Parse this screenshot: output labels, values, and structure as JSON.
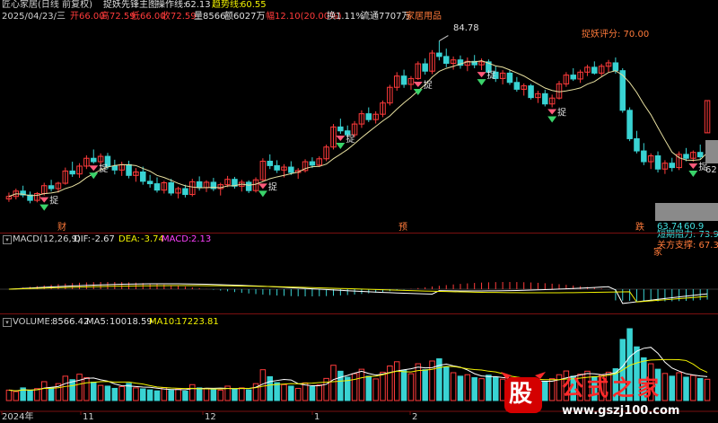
{
  "window": {
    "title": "匠心家居(日线 前复权)"
  },
  "header": {
    "date": "2025/04/23/三",
    "open_label": "开",
    "open": "66.00",
    "high_label": "高",
    "high": "72.59",
    "low_label": "低",
    "low": "66.00",
    "close_label": "收",
    "close": "72.59",
    "vol_label": "量",
    "vol": "8566",
    "amount_label": "额",
    "amount": "6027万",
    "chg_label": "幅",
    "chg": "12.10(20.00%)",
    "turnover": "换1.11%",
    "float": "流通7707万",
    "industry": "家居用品"
  },
  "indicator": {
    "name": "捉妖先锋主图",
    "op_label": "操作线:",
    "op_value": "62.13",
    "trend_label": "趋势线:",
    "trend_value": "60.55"
  },
  "annotations": {
    "peak": "84.78",
    "score": "捉妖评分: 70.00",
    "catch": "捉",
    "price_mark": "62",
    "low_mark": "63.74",
    "low_value": "60.9",
    "resistance": "短期阻力: 73.91",
    "support": "关方支撑: 67.32",
    "event_cai": "财",
    "event_yu": "预",
    "event_die": "跌",
    "event_jia": "家"
  },
  "macd": {
    "title": "MACD(12,26,9)",
    "dif_label": "DIF:",
    "dif": "-2.67",
    "dea_label": "DEA:",
    "dea": "-3.74",
    "macd_label": "MACD:",
    "macd": "2.13"
  },
  "volume": {
    "title": "VOLUME:",
    "value": "8566.42",
    "ma5_label": "MA5:",
    "ma5": "10018.59",
    "ma10_label": "MA10:",
    "ma10": "17223.81"
  },
  "xaxis": {
    "year": "2024年",
    "m11": "11",
    "m12": "12",
    "m1": "1",
    "m2": "2"
  },
  "watermark": {
    "logo": "股",
    "name": "公式之家",
    "url": "www.gszj100.com"
  },
  "colors": {
    "up": "#ff3b3b",
    "down": "#39d3d3",
    "bg": "#000000",
    "ma": "#e8e0a0"
  },
  "chart_data": {
    "type": "candlestick",
    "ylim": [
      48,
      88
    ],
    "candles": [
      [
        52.5,
        53.8,
        51.9,
        53.0
      ],
      [
        53.0,
        54.6,
        52.4,
        54.1
      ],
      [
        54.1,
        55.2,
        52.8,
        53.3
      ],
      [
        53.3,
        54.0,
        51.6,
        52.2
      ],
      [
        52.2,
        53.9,
        51.8,
        53.6
      ],
      [
        53.6,
        55.8,
        53.2,
        55.2
      ],
      [
        55.2,
        56.4,
        54.0,
        54.6
      ],
      [
        54.6,
        56.0,
        53.8,
        55.7
      ],
      [
        55.7,
        58.9,
        55.4,
        58.2
      ],
      [
        58.2,
        60.1,
        57.0,
        57.6
      ],
      [
        57.6,
        59.8,
        56.8,
        59.2
      ],
      [
        59.2,
        61.4,
        58.6,
        60.8
      ],
      [
        60.8,
        62.6,
        59.7,
        60.1
      ],
      [
        60.1,
        61.8,
        58.9,
        61.2
      ],
      [
        61.2,
        61.9,
        58.6,
        59.2
      ],
      [
        59.2,
        60.5,
        57.5,
        58.4
      ],
      [
        58.4,
        60.1,
        57.2,
        59.5
      ],
      [
        59.5,
        60.3,
        56.7,
        57.3
      ],
      [
        57.3,
        58.8,
        56.0,
        58.0
      ],
      [
        58.0,
        59.1,
        55.4,
        56.1
      ],
      [
        56.1,
        57.4,
        54.8,
        55.6
      ],
      [
        55.6,
        56.9,
        53.8,
        54.3
      ],
      [
        54.3,
        56.2,
        53.6,
        55.8
      ],
      [
        55.8,
        56.6,
        53.2,
        53.7
      ],
      [
        53.7,
        55.0,
        52.6,
        54.6
      ],
      [
        54.6,
        55.4,
        52.8,
        53.4
      ],
      [
        53.4,
        56.6,
        53.0,
        56.0
      ],
      [
        56.0,
        57.1,
        54.2,
        54.8
      ],
      [
        54.8,
        56.3,
        53.9,
        55.9
      ],
      [
        55.9,
        56.8,
        54.1,
        54.6
      ],
      [
        54.6,
        55.8,
        53.2,
        55.4
      ],
      [
        55.4,
        57.2,
        54.9,
        56.5
      ],
      [
        56.5,
        57.0,
        54.6,
        55.1
      ],
      [
        55.1,
        56.4,
        54.0,
        55.9
      ],
      [
        55.9,
        56.3,
        53.7,
        54.2
      ],
      [
        54.2,
        56.9,
        53.8,
        56.4
      ],
      [
        56.4,
        60.8,
        56.0,
        60.2
      ],
      [
        60.2,
        61.6,
        58.6,
        59.3
      ],
      [
        59.3,
        60.4,
        57.8,
        58.4
      ],
      [
        58.4,
        59.6,
        56.9,
        59.0
      ],
      [
        59.0,
        60.2,
        57.4,
        57.9
      ],
      [
        57.9,
        58.8,
        56.6,
        58.3
      ],
      [
        58.3,
        60.6,
        57.9,
        60.1
      ],
      [
        60.1,
        61.0,
        58.8,
        59.4
      ],
      [
        59.4,
        61.2,
        59.0,
        60.7
      ],
      [
        60.7,
        63.6,
        60.2,
        63.1
      ],
      [
        63.1,
        67.8,
        62.6,
        67.2
      ],
      [
        67.2,
        68.9,
        65.8,
        66.4
      ],
      [
        66.4,
        67.5,
        64.9,
        65.6
      ],
      [
        65.6,
        68.4,
        65.1,
        67.8
      ],
      [
        67.8,
        70.6,
        67.0,
        69.9
      ],
      [
        69.9,
        71.2,
        68.2,
        68.7
      ],
      [
        68.7,
        70.4,
        67.9,
        69.8
      ],
      [
        69.8,
        72.6,
        69.2,
        72.1
      ],
      [
        72.1,
        75.8,
        71.6,
        75.3
      ],
      [
        75.3,
        78.4,
        74.6,
        77.6
      ],
      [
        77.6,
        78.9,
        75.2,
        75.9
      ],
      [
        75.9,
        77.6,
        74.8,
        77.1
      ],
      [
        77.1,
        80.6,
        76.8,
        80.1
      ],
      [
        80.1,
        81.2,
        77.9,
        78.6
      ],
      [
        78.6,
        82.9,
        78.0,
        82.3
      ],
      [
        82.3,
        84.78,
        80.8,
        81.6
      ],
      [
        81.6,
        83.2,
        79.4,
        80.2
      ],
      [
        80.2,
        81.6,
        78.9,
        80.9
      ],
      [
        80.9,
        81.8,
        79.1,
        79.8
      ],
      [
        79.8,
        81.4,
        78.6,
        80.6
      ],
      [
        80.6,
        81.9,
        79.2,
        79.9
      ],
      [
        79.9,
        81.2,
        78.8,
        80.5
      ],
      [
        80.5,
        81.0,
        77.8,
        78.4
      ],
      [
        78.4,
        79.6,
        76.4,
        77.1
      ],
      [
        77.1,
        78.8,
        75.9,
        78.2
      ],
      [
        78.2,
        78.9,
        75.8,
        76.3
      ],
      [
        76.3,
        77.4,
        74.4,
        74.9
      ],
      [
        74.9,
        76.1,
        73.6,
        75.6
      ],
      [
        75.6,
        76.0,
        72.8,
        73.2
      ],
      [
        73.2,
        74.6,
        72.1,
        74.0
      ],
      [
        74.0,
        74.8,
        71.4,
        71.9
      ],
      [
        71.9,
        73.8,
        71.2,
        73.1
      ],
      [
        73.1,
        76.6,
        72.8,
        76.0
      ],
      [
        76.0,
        78.4,
        75.4,
        77.8
      ],
      [
        77.8,
        79.2,
        76.6,
        77.0
      ],
      [
        77.0,
        78.9,
        76.2,
        78.4
      ],
      [
        78.4,
        79.9,
        77.6,
        79.4
      ],
      [
        79.4,
        80.6,
        77.9,
        78.2
      ],
      [
        78.2,
        80.1,
        77.6,
        79.6
      ],
      [
        79.6,
        80.9,
        78.4,
        80.3
      ],
      [
        80.3,
        81.4,
        78.1,
        78.7
      ],
      [
        78.7,
        79.2,
        70.1,
        70.6
      ],
      [
        70.6,
        71.2,
        64.3,
        64.8
      ],
      [
        64.8,
        66.4,
        61.8,
        62.3
      ],
      [
        62.3,
        63.9,
        59.4,
        60.1
      ],
      [
        60.1,
        61.8,
        58.6,
        61.3
      ],
      [
        61.3,
        62.2,
        57.9,
        58.6
      ],
      [
        58.6,
        60.4,
        57.6,
        59.8
      ],
      [
        59.8,
        60.9,
        58.1,
        58.9
      ],
      [
        58.9,
        62.2,
        58.4,
        61.6
      ],
      [
        61.6,
        62.9,
        60.2,
        60.8
      ],
      [
        60.8,
        62.4,
        60.1,
        62.0
      ],
      [
        62.0,
        63.6,
        60.5,
        61.1
      ],
      [
        66.0,
        72.59,
        66.0,
        72.59
      ]
    ],
    "volume_series": [
      4200,
      3600,
      5100,
      3900,
      4800,
      7600,
      5200,
      6800,
      9800,
      8400,
      10600,
      9200,
      7400,
      6100,
      5800,
      4900,
      5600,
      6900,
      5100,
      4700,
      4300,
      3900,
      5200,
      4100,
      4600,
      3800,
      6400,
      5100,
      4900,
      4400,
      4200,
      5800,
      4700,
      5100,
      4300,
      6800,
      12400,
      9600,
      7200,
      6400,
      5800,
      4900,
      7100,
      5600,
      6300,
      8900,
      14200,
      11800,
      9400,
      10800,
      12600,
      9800,
      8700,
      11400,
      13900,
      15600,
      12200,
      10800,
      14800,
      12400,
      15900,
      16800,
      13400,
      11200,
      9800,
      10400,
      9200,
      8800,
      10200,
      9400,
      8600,
      7900,
      8800,
      7400,
      8200,
      6900,
      7600,
      8800,
      10400,
      11900,
      9800,
      10600,
      11800,
      9600,
      10200,
      11400,
      12800,
      24600,
      28900,
      21600,
      17200,
      14800,
      12600,
      10900,
      9800,
      11200,
      9400,
      10100,
      8900,
      8566
    ],
    "ma5_volume": [
      10018.59
    ],
    "ma10_volume": [
      17223.81
    ],
    "macd": {
      "dif": -2.67,
      "dea": -3.74,
      "macd": 2.13
    },
    "peak_value": 84.78,
    "support": 67.32,
    "resistance": 73.91
  }
}
